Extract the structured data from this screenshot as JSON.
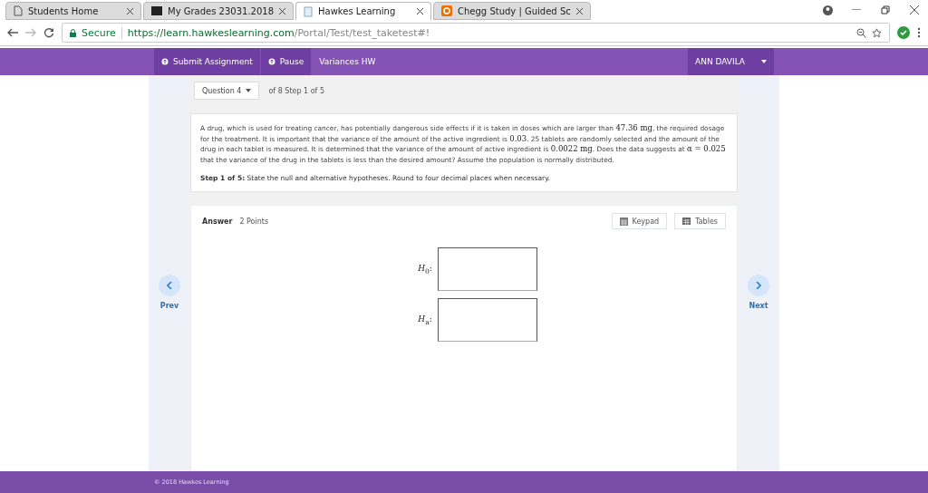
{
  "browser": {
    "tabs": [
      {
        "title": "Students Home",
        "kind": "page",
        "selected": false
      },
      {
        "title": "My Grades    23031.2018",
        "kind": "grades",
        "selected": false
      },
      {
        "title": "Hawkes Learning",
        "kind": "document",
        "selected": true
      },
      {
        "title": "Chegg Study | Guided Sc",
        "kind": "letter",
        "selected": false
      }
    ],
    "secure_label": "Secure",
    "url_host": "https://learn.hawkeslearning.com",
    "url_path": "/Portal/Test/test_taketest#!"
  },
  "nav": {
    "submit": "Submit Assignment",
    "pause": "Pause",
    "assignment": "Variances HW",
    "user": "ANN DAVILA"
  },
  "question": {
    "selector": "Question 4",
    "position": "of 8 Step 1 of 5",
    "problem": [
      {
        "kind": "text",
        "text": "A drug, which is used for treating cancer, has potentially dangerous side effects if it is taken in doses which are larger than "
      },
      {
        "kind": "math",
        "text": "47.36 mg"
      },
      {
        "kind": "text",
        "text": ", the required dosage for the treatment. It is important that the variance of the amount of the active ingredient is "
      },
      {
        "kind": "math",
        "text": "0.03"
      },
      {
        "kind": "text",
        "text": ". 25 tablets are randomly selected and the amount of the drug in each tablet is measured. It is determined that the variance of the amount of active ingredient is "
      },
      {
        "kind": "math",
        "text": "0.0022 mg"
      },
      {
        "kind": "text",
        "text": ". Does the data suggests at "
      },
      {
        "kind": "math",
        "text": "α = 0.025"
      },
      {
        "kind": "text",
        "text": " that the variance of the drug in the tablets is less than the desired amount? Assume the population is normally distributed."
      }
    ],
    "step": "**Step 1 of 5:** State the null and alternative hypotheses. Round to four decimal places when necessary."
  },
  "answer": {
    "label": "Answer",
    "points": "2 Points",
    "keypad": "Keypad",
    "tables": "Tables",
    "fields": [
      {
        "label": "*H*$_{0}$:"
      },
      {
        "label": "*H*$_{a}$:"
      }
    ]
  },
  "prev": "Prev",
  "next": "Next",
  "footer": "© 2018 Hawkes Learning"
}
